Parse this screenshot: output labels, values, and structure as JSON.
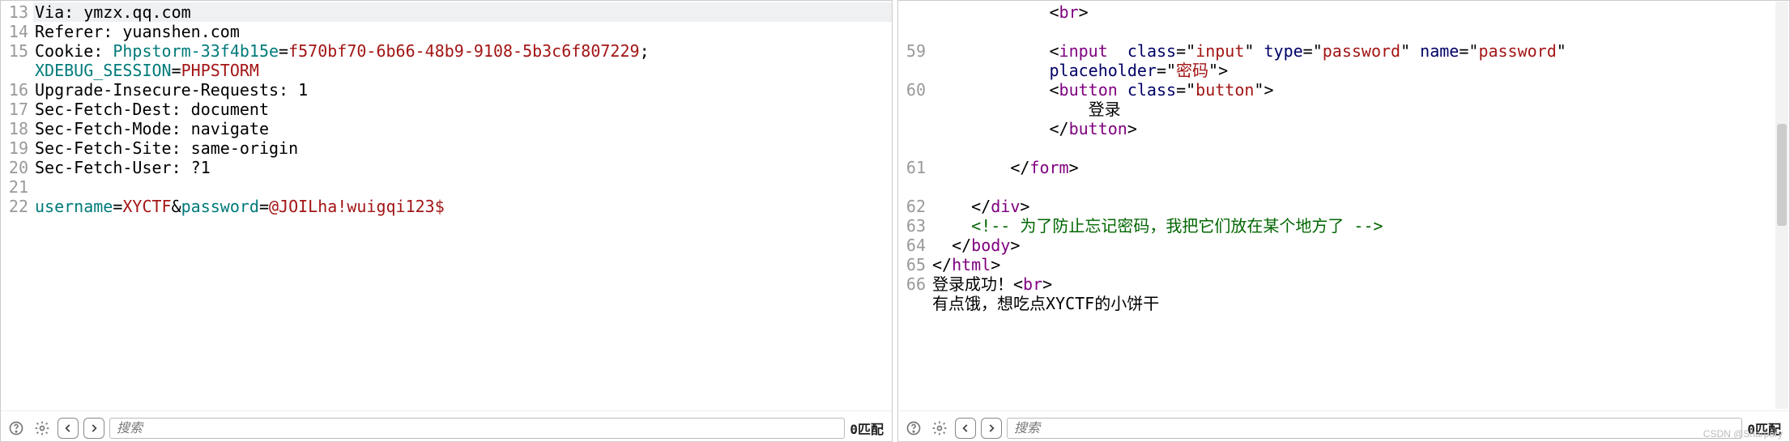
{
  "left": {
    "lines": [
      {
        "n": 13,
        "hl": true,
        "spans": [
          {
            "t": "Via: ",
            "c": "k-plain"
          },
          {
            "t": "ymzx.qq.com",
            "c": "k-plain"
          }
        ]
      },
      {
        "n": 14,
        "spans": [
          {
            "t": "Referer: ",
            "c": "k-plain"
          },
          {
            "t": "yuanshen.com",
            "c": "k-plain"
          }
        ]
      },
      {
        "n": 15,
        "spans": [
          {
            "t": "Cookie: ",
            "c": "k-plain"
          },
          {
            "t": "Phpstorm-33f4b15e",
            "c": "k-param"
          },
          {
            "t": "=",
            "c": "k-plain"
          },
          {
            "t": "f570bf70-6b66-48b9-9108-5b3c6f807229",
            "c": "k-red"
          },
          {
            "t": "; ",
            "c": "k-plain"
          }
        ]
      },
      {
        "n": "",
        "spans": [
          {
            "t": "XDEBUG_SESSION",
            "c": "k-param"
          },
          {
            "t": "=",
            "c": "k-plain"
          },
          {
            "t": "PHPSTORM",
            "c": "k-red"
          }
        ]
      },
      {
        "n": 16,
        "spans": [
          {
            "t": "Upgrade-Insecure-Requests: ",
            "c": "k-plain"
          },
          {
            "t": "1",
            "c": "k-plain"
          }
        ]
      },
      {
        "n": 17,
        "spans": [
          {
            "t": "Sec-Fetch-Dest: ",
            "c": "k-plain"
          },
          {
            "t": "document",
            "c": "k-plain"
          }
        ]
      },
      {
        "n": 18,
        "spans": [
          {
            "t": "Sec-Fetch-Mode: ",
            "c": "k-plain"
          },
          {
            "t": "navigate",
            "c": "k-plain"
          }
        ]
      },
      {
        "n": 19,
        "spans": [
          {
            "t": "Sec-Fetch-Site: ",
            "c": "k-plain"
          },
          {
            "t": "same-origin",
            "c": "k-plain"
          }
        ]
      },
      {
        "n": 20,
        "spans": [
          {
            "t": "Sec-Fetch-User: ",
            "c": "k-plain"
          },
          {
            "t": "?1",
            "c": "k-plain"
          }
        ]
      },
      {
        "n": 21,
        "spans": [
          {
            "t": "",
            "c": "k-plain"
          }
        ]
      },
      {
        "n": 22,
        "spans": [
          {
            "t": "username",
            "c": "k-param"
          },
          {
            "t": "=",
            "c": "k-plain"
          },
          {
            "t": "XYCTF",
            "c": "k-red"
          },
          {
            "t": "&",
            "c": "k-plain"
          },
          {
            "t": "password",
            "c": "k-param"
          },
          {
            "t": "=",
            "c": "k-plain"
          },
          {
            "t": "@JOILha!wuigqi123$",
            "c": "k-red"
          }
        ]
      }
    ],
    "search_placeholder": "搜索",
    "match_label": "0匹配"
  },
  "right": {
    "lines": [
      {
        "n": "",
        "spans": [
          {
            "t": "            <",
            "c": "k-plain"
          },
          {
            "t": "br",
            "c": "k-tag"
          },
          {
            "t": ">",
            "c": "k-plain"
          }
        ]
      },
      {
        "n": "",
        "spans": [
          {
            "t": "",
            "c": "k-plain"
          }
        ]
      },
      {
        "n": 59,
        "spans": [
          {
            "t": "            <",
            "c": "k-plain"
          },
          {
            "t": "input",
            "c": "k-tag"
          },
          {
            "t": "  ",
            "c": "k-plain"
          },
          {
            "t": "class",
            "c": "k-attr"
          },
          {
            "t": "=\"",
            "c": "k-plain"
          },
          {
            "t": "input",
            "c": "k-red"
          },
          {
            "t": "\" ",
            "c": "k-plain"
          },
          {
            "t": "type",
            "c": "k-attr"
          },
          {
            "t": "=\"",
            "c": "k-plain"
          },
          {
            "t": "password",
            "c": "k-red"
          },
          {
            "t": "\" ",
            "c": "k-plain"
          },
          {
            "t": "name",
            "c": "k-attr"
          },
          {
            "t": "=\"",
            "c": "k-plain"
          },
          {
            "t": "password",
            "c": "k-red"
          },
          {
            "t": "\" ",
            "c": "k-plain"
          }
        ]
      },
      {
        "n": "",
        "spans": [
          {
            "t": "            ",
            "c": "k-plain"
          },
          {
            "t": "placeholder",
            "c": "k-attr"
          },
          {
            "t": "=\"",
            "c": "k-plain"
          },
          {
            "t": "密码",
            "c": "k-red"
          },
          {
            "t": "\">",
            "c": "k-plain"
          }
        ]
      },
      {
        "n": 60,
        "spans": [
          {
            "t": "            <",
            "c": "k-plain"
          },
          {
            "t": "button",
            "c": "k-tag"
          },
          {
            "t": " ",
            "c": "k-plain"
          },
          {
            "t": "class",
            "c": "k-attr"
          },
          {
            "t": "=\"",
            "c": "k-plain"
          },
          {
            "t": "button",
            "c": "k-red"
          },
          {
            "t": "\">",
            "c": "k-plain"
          }
        ]
      },
      {
        "n": "",
        "spans": [
          {
            "t": "                登录",
            "c": "k-plain"
          }
        ]
      },
      {
        "n": "",
        "spans": [
          {
            "t": "            </",
            "c": "k-plain"
          },
          {
            "t": "button",
            "c": "k-tag"
          },
          {
            "t": ">",
            "c": "k-plain"
          }
        ]
      },
      {
        "n": "",
        "spans": [
          {
            "t": "",
            "c": "k-plain"
          }
        ]
      },
      {
        "n": 61,
        "spans": [
          {
            "t": "        </",
            "c": "k-plain"
          },
          {
            "t": "form",
            "c": "k-tag"
          },
          {
            "t": ">",
            "c": "k-plain"
          }
        ]
      },
      {
        "n": "",
        "spans": [
          {
            "t": "",
            "c": "k-plain"
          }
        ]
      },
      {
        "n": 62,
        "spans": [
          {
            "t": "    </",
            "c": "k-plain"
          },
          {
            "t": "div",
            "c": "k-tag"
          },
          {
            "t": ">",
            "c": "k-plain"
          }
        ]
      },
      {
        "n": 63,
        "spans": [
          {
            "t": "    ",
            "c": "k-plain"
          },
          {
            "t": "<!-- 为了防止忘记密码，我把它们放在某个地方了 -->",
            "c": "k-com"
          }
        ]
      },
      {
        "n": 64,
        "spans": [
          {
            "t": "  </",
            "c": "k-plain"
          },
          {
            "t": "body",
            "c": "k-tag"
          },
          {
            "t": ">",
            "c": "k-plain"
          }
        ]
      },
      {
        "n": 65,
        "spans": [
          {
            "t": "</",
            "c": "k-plain"
          },
          {
            "t": "html",
            "c": "k-tag"
          },
          {
            "t": ">",
            "c": "k-plain"
          }
        ]
      },
      {
        "n": 66,
        "spans": [
          {
            "t": "登录成功！",
            "c": "k-plain"
          },
          {
            "t": "<",
            "c": "k-plain"
          },
          {
            "t": "br",
            "c": "k-tag"
          },
          {
            "t": ">",
            "c": "k-plain"
          }
        ]
      },
      {
        "n": "",
        "spans": [
          {
            "t": "有点饿，想吃点XYCTF的小饼干",
            "c": "k-plain"
          }
        ]
      }
    ],
    "search_placeholder": "搜索",
    "match_label": "0匹配"
  },
  "watermark": "CSDN @Sharpery"
}
